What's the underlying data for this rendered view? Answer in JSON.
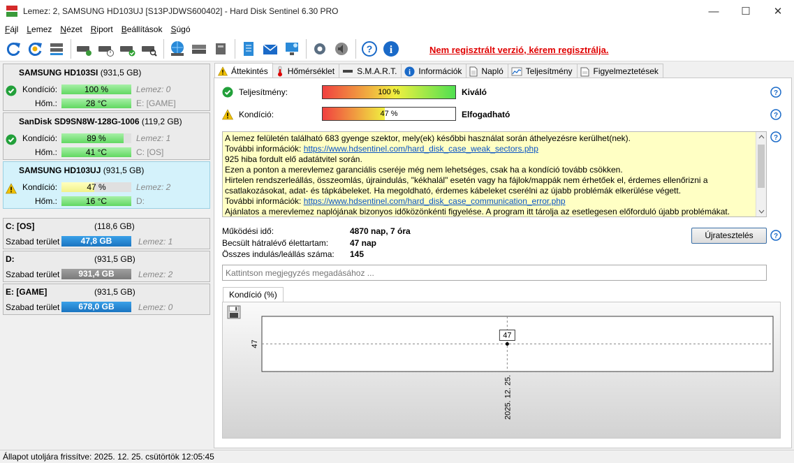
{
  "window": {
    "title": "Lemez: 2, SAMSUNG HD103UJ [S13PJDWS600402]  -  Hard Disk Sentinel 6.30 PRO",
    "minimize": "—",
    "maximize": "☐",
    "close": "✕"
  },
  "menu": [
    {
      "key": "F",
      "rest": "ájl"
    },
    {
      "key": "L",
      "rest": "emez"
    },
    {
      "key": "N",
      "rest": "ézet"
    },
    {
      "key": "R",
      "rest": "iport"
    },
    {
      "key": "B",
      "rest": "eállítások"
    },
    {
      "key": "S",
      "rest": "úgó"
    }
  ],
  "toolbar": {
    "registration_warning": "Nem regisztrált verzió, kérem regisztrálja."
  },
  "disks": [
    {
      "name": "SAMSUNG HD103SI",
      "size": "(931,5 GB)",
      "condition_label": "Kondíció:",
      "condition": "100 %",
      "condition_value": 100,
      "disk_ref": "Lemez: 0",
      "temp_label": "Hőm.:",
      "temp": "28 °C",
      "drive": "E: [GAME]",
      "status": "ok"
    },
    {
      "name": "SanDisk SD9SN8W-128G-1006",
      "size": "(119,2 GB)",
      "condition_label": "Kondíció:",
      "condition": "89 %",
      "condition_value": 89,
      "disk_ref": "Lemez: 1",
      "temp_label": "Hőm.:",
      "temp": "41 °C",
      "drive": "C: [OS]",
      "status": "ok"
    },
    {
      "name": "SAMSUNG HD103UJ",
      "size": "(931,5 GB)",
      "condition_label": "Kondíció:",
      "condition": "47 %",
      "condition_value": 47,
      "disk_ref": "Lemez: 2",
      "temp_label": "Hőm.:",
      "temp": "16 °C",
      "drive": "D:",
      "status": "warning"
    }
  ],
  "volumes": [
    {
      "name": "C: [OS]",
      "size": "(118,6 GB)",
      "free_label": "Szabad terület",
      "free": "47,8 GB",
      "disk_ref": "Lemez: 1",
      "color": "blue"
    },
    {
      "name": "D:",
      "size": "(931,5 GB)",
      "free_label": "Szabad terület",
      "free": "931,4 GB",
      "disk_ref": "Lemez: 2",
      "color": "gray"
    },
    {
      "name": "E: [GAME]",
      "size": "(931,5 GB)",
      "free_label": "Szabad terület",
      "free": "678,0 GB",
      "disk_ref": "Lemez: 0",
      "color": "blue"
    }
  ],
  "tabs": [
    {
      "label": "Áttekintés",
      "icon": "warning-icon"
    },
    {
      "label": "Hőmérséklet",
      "icon": "thermometer-icon"
    },
    {
      "label": "S.M.A.R.T.",
      "icon": "disk-icon"
    },
    {
      "label": "Információk",
      "icon": "info-icon"
    },
    {
      "label": "Napló",
      "icon": "document-icon"
    },
    {
      "label": "Teljesítmény",
      "icon": "chart-icon"
    },
    {
      "label": "Figyelmeztetések",
      "icon": "alerts-icon"
    }
  ],
  "overview": {
    "performance_label": "Teljesítmény:",
    "performance_value": "100 %",
    "performance_pct": 100,
    "performance_text": "Kiváló",
    "condition_label": "Kondíció:",
    "condition_value": "47 %",
    "condition_pct": 47,
    "condition_text": "Elfogadható",
    "message_lines": [
      {
        "text": "A lemez felületén található 683 gyenge szektor, mely(ek) későbbi használat során áthelyezésre kerülhet(nek).",
        "link": ""
      },
      {
        "text": "További információk: ",
        "link": "https://www.hdsentinel.com/hard_disk_case_weak_sectors.php"
      },
      {
        "text": "925 hiba fordult elő adatátvitel során.",
        "link": ""
      },
      {
        "text": "Ezen a ponton a merevlemez garanciális cseréje még nem lehetséges, csak ha a kondíció tovább csökken.",
        "link": ""
      },
      {
        "text": "Hirtelen rendszerleállás, összeomlás, újraindulás, \"kékhalál\" esetén vagy ha fájlok/mappák nem érhetőek el, érdemes ellenőrizni a",
        "link": ""
      },
      {
        "text": "csatlakozásokat, adat- és tápkábeleket. Ha megoldható, érdemes kábeleket cserélni az újabb problémák elkerülése végett.",
        "link": ""
      },
      {
        "text": "További információk: ",
        "link": "https://www.hdsentinel.com/hard_disk_case_communication_error.php"
      },
      {
        "text": "Ajánlatos a merevlemez naplójának bizonyos időközönkénti figyelése. A program itt tárolja az esetlegesen előforduló újabb problémákat.",
        "link": ""
      }
    ],
    "uptime_label": "Működési idő:",
    "uptime": "4870 nap, 7 óra",
    "lifetime_label": "Becsült hátralévő élettartam:",
    "lifetime": "47 nap",
    "startstop_label": "Összes indulás/leállás száma:",
    "startstop": "145",
    "retest_button": "Újratesztelés",
    "note_placeholder": "Kattintson megjegyzés megadásához ...",
    "chart_tab": "Kondíció  (%)"
  },
  "chart_data": {
    "type": "scatter",
    "x": [
      "2025. 12. 25."
    ],
    "values": [
      47
    ],
    "y_tick": "47",
    "point_label": "47",
    "x_tick": "2025. 12. 25."
  },
  "statusbar": {
    "text": "Állapot utoljára frissítve: 2025. 12. 25. csütörtök 12:05:45"
  },
  "colors": {
    "ok": "#22a03a",
    "warning": "#f0c000",
    "info": "#0a64d2",
    "link": "#0a54c4",
    "registration": "#e00000"
  }
}
